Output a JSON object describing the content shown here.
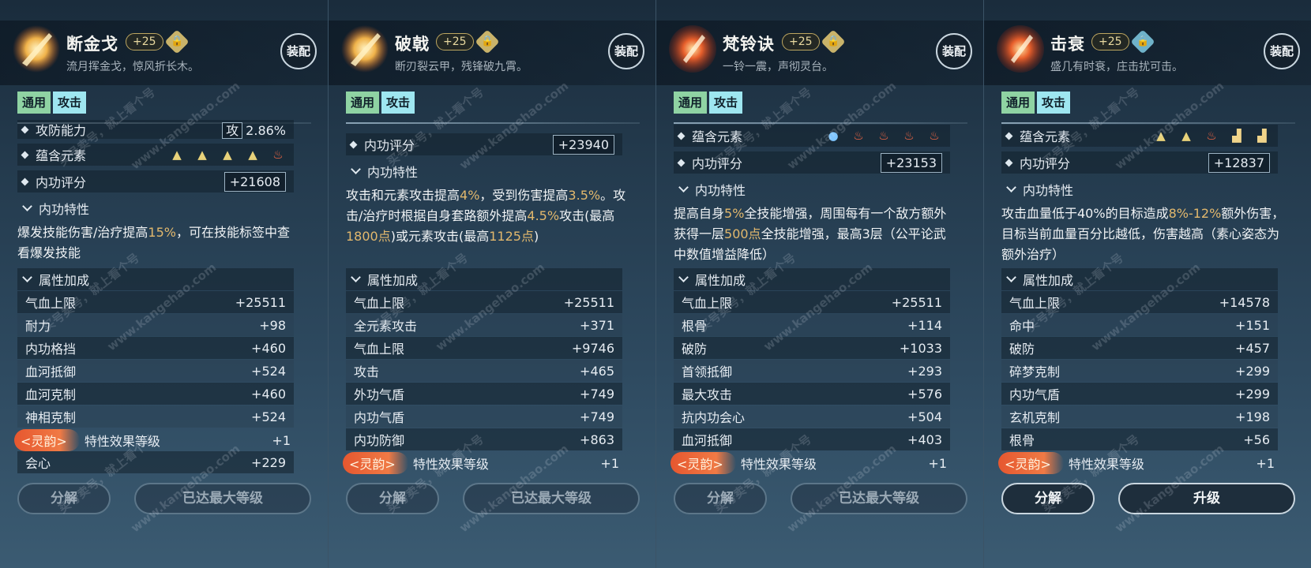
{
  "colors": {
    "accent_gold": "#e2b86d",
    "lingyun_orange": "#e6572f",
    "tag_green": "#8fd3a3",
    "tag_blue": "#9ee6f0"
  },
  "panels": [
    {
      "name": "断金戈",
      "level": "+25",
      "lock": "lock-icon",
      "motto": "流月挥金戈，惊风折长木。",
      "equip": "装配",
      "tags": [
        "通用",
        "攻击"
      ],
      "partial_row": {
        "label": "攻防能力",
        "box": "攻",
        "value": "2.86%"
      },
      "element_row": {
        "label": "蕴含元素",
        "icons": [
          "rock-triangle-icon",
          "rock-triangle-icon",
          "rock-triangle-icon",
          "rock-triangle-icon",
          "fire-icon"
        ]
      },
      "score": {
        "label": "内功评分",
        "value": "+21608"
      },
      "trait_title": "内功特性",
      "trait_text": [
        {
          "t": "爆发技能伤害/治疗提高",
          "h": false
        },
        {
          "t": "15%",
          "h": true
        },
        {
          "t": "，可在技能标签中查看爆发技能",
          "h": false
        }
      ],
      "attr_title": "属性加成",
      "attrs": [
        [
          "气血上限",
          "+25511"
        ],
        [
          "耐力",
          "+98"
        ],
        [
          "内功格挡",
          "+460"
        ],
        [
          "血河抵御",
          "+524"
        ],
        [
          "血河克制",
          "+460"
        ],
        [
          "神相克制",
          "+524"
        ]
      ],
      "lingyun": {
        "pill": "<灵韵>",
        "label": "特性效果等级",
        "value": "+1"
      },
      "after": [
        [
          "会心",
          "+229"
        ]
      ],
      "buttons": [
        {
          "label": "分解",
          "on": false
        },
        {
          "label": "已达最大等级",
          "on": false
        }
      ]
    },
    {
      "name": "破戟",
      "level": "+25",
      "lock": "lock-icon",
      "motto": "断刃裂云甲，残锋破九霄。",
      "equip": "装配",
      "tags": [
        "通用",
        "攻击"
      ],
      "score": {
        "label": "内功评分",
        "value": "+23940"
      },
      "trait_title": "内功特性",
      "trait_text": [
        {
          "t": "攻击和元素攻击提高",
          "h": false
        },
        {
          "t": "4%",
          "h": true
        },
        {
          "t": "，受到伤害提高",
          "h": false
        },
        {
          "t": "3.5%",
          "h": true
        },
        {
          "t": "。攻击/治疗时根据自身套路额外提高",
          "h": false
        },
        {
          "t": "4.5%",
          "h": true
        },
        {
          "t": "攻击(最高",
          "h": false
        },
        {
          "t": "1800点",
          "h": true
        },
        {
          "t": ")或元素攻击(最高",
          "h": false
        },
        {
          "t": "1125点",
          "h": true
        },
        {
          "t": ")",
          "h": false
        }
      ],
      "attr_title": "属性加成",
      "attrs": [
        [
          "气血上限",
          "+25511"
        ],
        [
          "全元素攻击",
          "+371"
        ],
        [
          "气血上限",
          "+9746"
        ],
        [
          "攻击",
          "+465"
        ],
        [
          "外功气盾",
          "+749"
        ],
        [
          "内功气盾",
          "+749"
        ],
        [
          "内功防御",
          "+863"
        ]
      ],
      "lingyun": {
        "pill": "<灵韵>",
        "label": "特性效果等级",
        "value": "+1"
      },
      "after": [],
      "buttons": [
        {
          "label": "分解",
          "on": false
        },
        {
          "label": "已达最大等级",
          "on": false
        }
      ]
    },
    {
      "name": "梵铃诀",
      "level": "+25",
      "lock": "lock-icon",
      "motto": "一铃一震，声彻灵台。",
      "equip": "装配",
      "tags": [
        "通用",
        "攻击"
      ],
      "element_row": {
        "label": "蕴含元素",
        "icons": [
          "water-drop-icon",
          "fire-icon",
          "fire-icon",
          "fire-icon",
          "fire-icon"
        ]
      },
      "score": {
        "label": "内功评分",
        "value": "+23153"
      },
      "trait_title": "内功特性",
      "trait_text": [
        {
          "t": "提高自身",
          "h": false
        },
        {
          "t": "5%",
          "h": true
        },
        {
          "t": "全技能增强，周围每有一个敌方额外获得一层",
          "h": false
        },
        {
          "t": "500点",
          "h": true
        },
        {
          "t": "全技能增强，最高3层（公平论武中数值增益降低）",
          "h": false
        }
      ],
      "attr_title": "属性加成",
      "attrs": [
        [
          "气血上限",
          "+25511"
        ],
        [
          "根骨",
          "+114"
        ],
        [
          "破防",
          "+1033"
        ],
        [
          "首领抵御",
          "+293"
        ],
        [
          "最大攻击",
          "+576"
        ],
        [
          "抗内功会心",
          "+504"
        ],
        [
          "血河抵御",
          "+403"
        ]
      ],
      "lingyun": {
        "pill": "<灵韵>",
        "label": "特性效果等级",
        "value": "+1"
      },
      "after": [],
      "buttons": [
        {
          "label": "分解",
          "on": false
        },
        {
          "label": "已达最大等级",
          "on": false
        }
      ]
    },
    {
      "name": "击衰",
      "level": "+25",
      "lock": "lock-icon",
      "motto": "盛几有时衰，庄击扰可击。",
      "equip": "装配",
      "tags": [
        "通用",
        "攻击"
      ],
      "element_row": {
        "label": "蕴含元素",
        "icons": [
          "rock-triangle-icon",
          "rock-triangle-icon",
          "fire-icon",
          "rock-block-icon",
          "rock-block-icon"
        ]
      },
      "score": {
        "label": "内功评分",
        "value": "+12837"
      },
      "trait_title": "内功特性",
      "trait_text": [
        {
          "t": "攻击血量低于40%的目标造成",
          "h": false
        },
        {
          "t": "8%-12%",
          "h": true
        },
        {
          "t": "额外伤害，目标当前血量百分比越低，伤害越高（素心姿态为额外治疗）",
          "h": false
        }
      ],
      "attr_title": "属性加成",
      "attrs": [
        [
          "气血上限",
          "+14578"
        ],
        [
          "命中",
          "+151"
        ],
        [
          "破防",
          "+457"
        ],
        [
          "碎梦克制",
          "+299"
        ],
        [
          "内功气盾",
          "+299"
        ],
        [
          "玄机克制",
          "+198"
        ],
        [
          "根骨",
          "+56"
        ]
      ],
      "lingyun": {
        "pill": "<灵韵>",
        "label": "特性效果等级",
        "value": "+1"
      },
      "after": [],
      "buttons": [
        {
          "label": "分解",
          "on": true
        },
        {
          "label": "升级",
          "on": true
        }
      ]
    }
  ],
  "watermark": {
    "line1": "买号卖号，就上看个号",
    "line2": "www.kangehao.com",
    "badge": "看个号"
  }
}
